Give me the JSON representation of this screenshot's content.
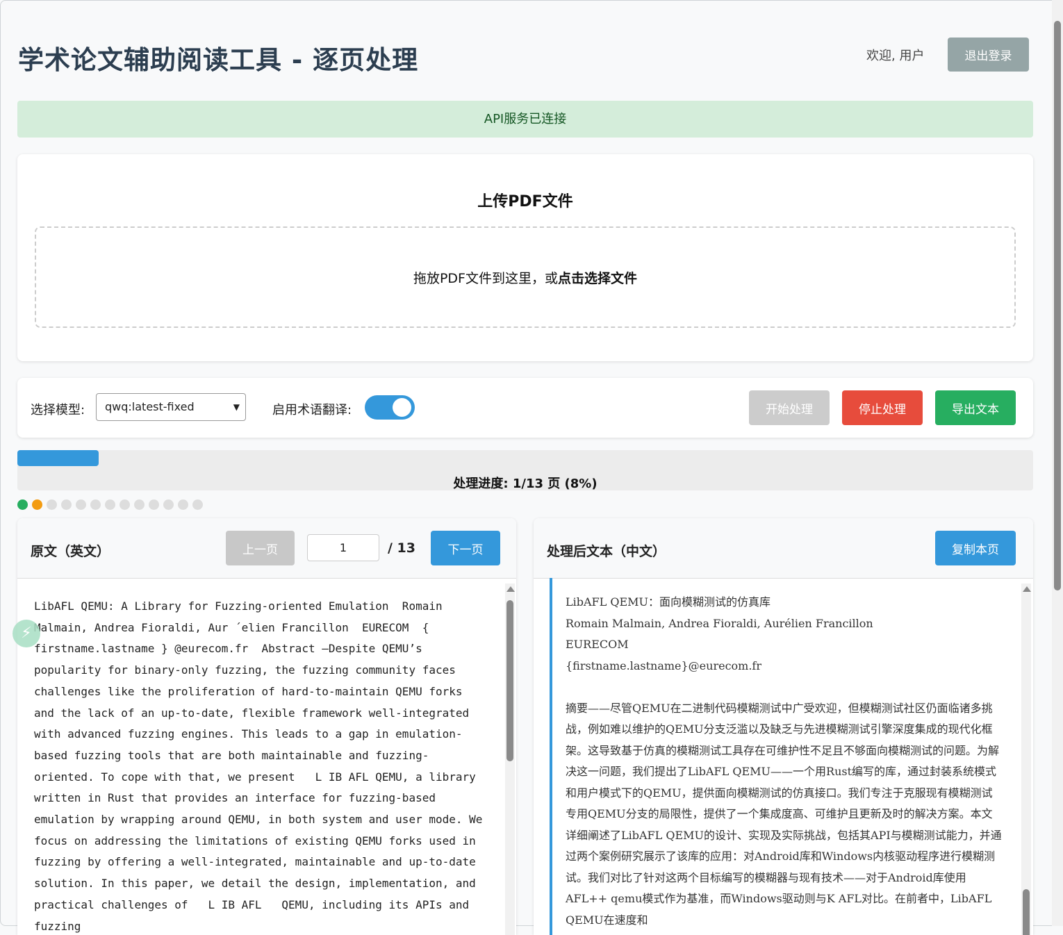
{
  "header": {
    "title": "学术论文辅助阅读工具 - 逐页处理",
    "welcome": "欢迎, 用户",
    "logout_label": "退出登录"
  },
  "status": {
    "message": "API服务已连接",
    "color": "#d4edda"
  },
  "upload": {
    "title": "上传PDF文件",
    "drop_text": "拖放PDF文件到这里，或",
    "drop_link": "点击选择文件"
  },
  "controls": {
    "model_label": "选择模型:",
    "model_value": "qwq:latest-fixed",
    "term_label": "启用术语翻译:",
    "term_enabled": true,
    "start_label": "开始处理",
    "stop_label": "停止处理",
    "export_label": "导出文本"
  },
  "progress": {
    "text": "处理进度: 1/13 页 (8%)",
    "percent": 8,
    "total_pages": 13,
    "page_status": [
      "done",
      "current",
      "pending",
      "pending",
      "pending",
      "pending",
      "pending",
      "pending",
      "pending",
      "pending",
      "pending",
      "pending",
      "pending"
    ]
  },
  "original": {
    "title": "原文（英文）",
    "prev_label": "上一页",
    "page_value": "1",
    "total": "/ 13",
    "next_label": "下一页",
    "text": "LibAFL QEMU: A Library for Fuzzing-oriented Emulation  Romain Malmain, Andrea Fioraldi, Aur ´elien Francillon  EURECOM  { firstname.lastname } @eurecom.fr  Abstract —Despite QEMU’s popularity for binary-only fuzzing, the fuzzing community faces challenges like the proliferation of hard-to-maintain QEMU forks and the lack of an up-to-date, flexible framework well-integrated with advanced fuzzing engines. This leads to a gap in emulation-based fuzzing tools that are both maintainable and fuzzing-oriented. To cope with that, we present   L IB AFL QEMU, a library written in Rust that provides an interface for fuzzing-based emulation by wrapping around QEMU, in both system and user mode. We focus on addressing the limitations of existing QEMU forks used in fuzzing by offering a well-integrated, maintainable and up-to-date solution. In this paper, we detail the design, implementation, and practical challenges of   L IB AFL   QEMU, including its APIs and fuzzing"
  },
  "translated": {
    "title": "处理后文本（中文）",
    "copy_label": "复制本页",
    "text": "LibAFL QEMU：面向模糊测试的仿真库\nRomain Malmain, Andrea Fioraldi, Aurélien Francillon\nEURECOM\n{firstname.lastname}@eurecom.fr\n\n摘要——尽管QEMU在二进制代码模糊测试中广受欢迎，但模糊测试社区仍面临诸多挑战，例如难以维护的QEMU分支泛滥以及缺乏与先进模糊测试引擎深度集成的现代化框架。这导致基于仿真的模糊测试工具存在可维护性不足且不够面向模糊测试的问题。为解决这一问题，我们提出了LibAFL QEMU——一个用Rust编写的库，通过封装系统模式和用户模式下的QEMU，提供面向模糊测试的仿真接口。我们专注于克服现有模糊测试专用QEMU分支的局限性，提供了一个集成度高、可维护且更新及时的解决方案。本文详细阐述了LibAFL QEMU的设计、实现及实际挑战，包括其API与模糊测试能力，并通过两个案例研究展示了该库的应用：对Android库和Windows内核驱动程序进行模糊测试。我们对比了针对这两个目标编写的模糊器与现有技术——对于Android库使用AFL++ qemu模式作为基准，而Windows驱动则与K AFL对比。在前者中，LibAFL QEMU在速度和"
  }
}
